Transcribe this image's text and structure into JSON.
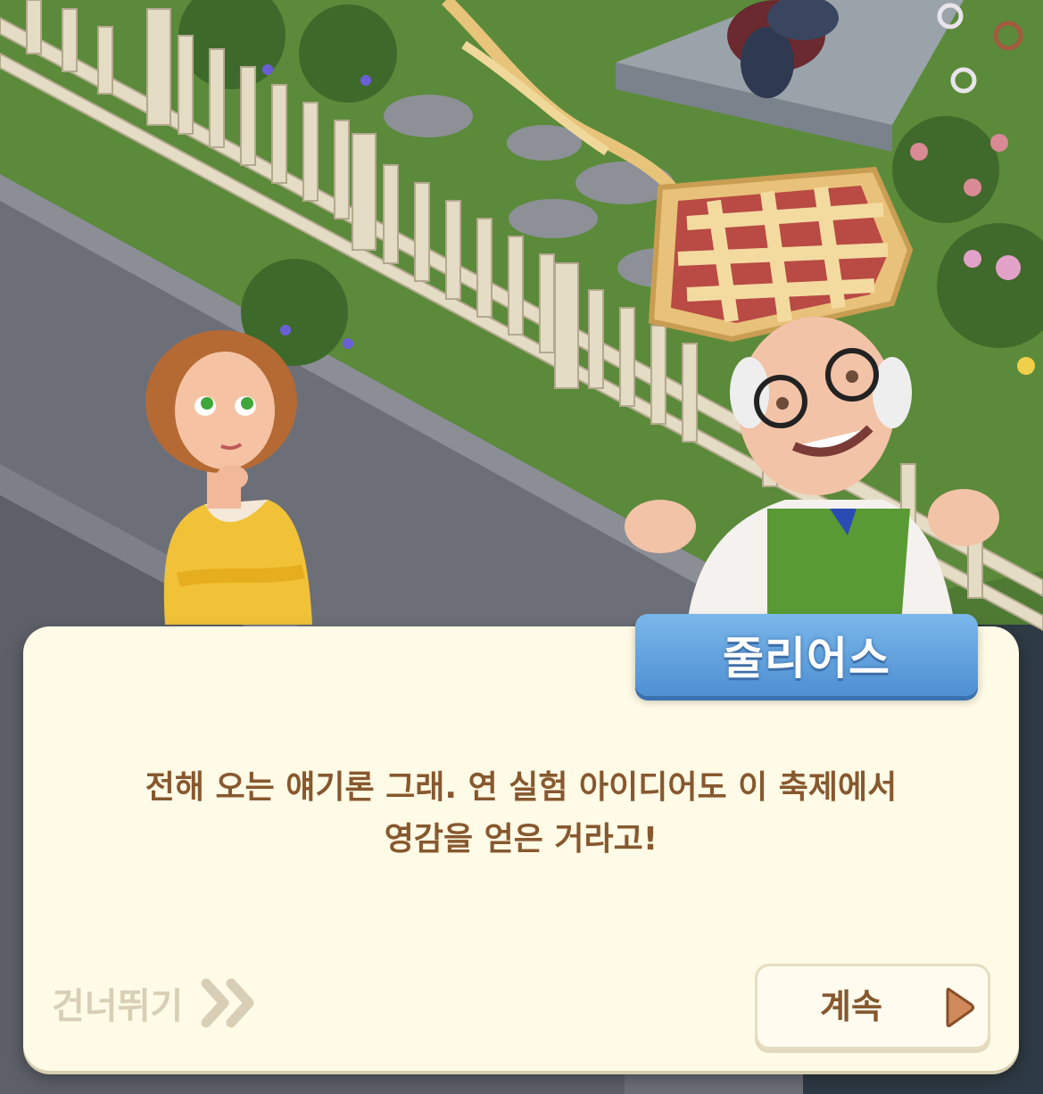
{
  "dialog": {
    "speaker_name": "줄리어스",
    "line1": "전해 오는 얘기론 그래. 연 실험 아이디어도 이 축제에서",
    "line2": "영감을 얻은 거라고!"
  },
  "buttons": {
    "skip_label": "건너뛰기",
    "continue_label": "계속"
  },
  "icons": {
    "skip": "double-chevron-right-icon",
    "continue": "play-triangle-icon"
  },
  "colors": {
    "panel_bg": "#fffbe6",
    "text_brown": "#87582f",
    "name_tag_blue": "#5b9bdb",
    "skip_gray": "#d8cfb6",
    "continue_arrow": "#d0895a"
  }
}
